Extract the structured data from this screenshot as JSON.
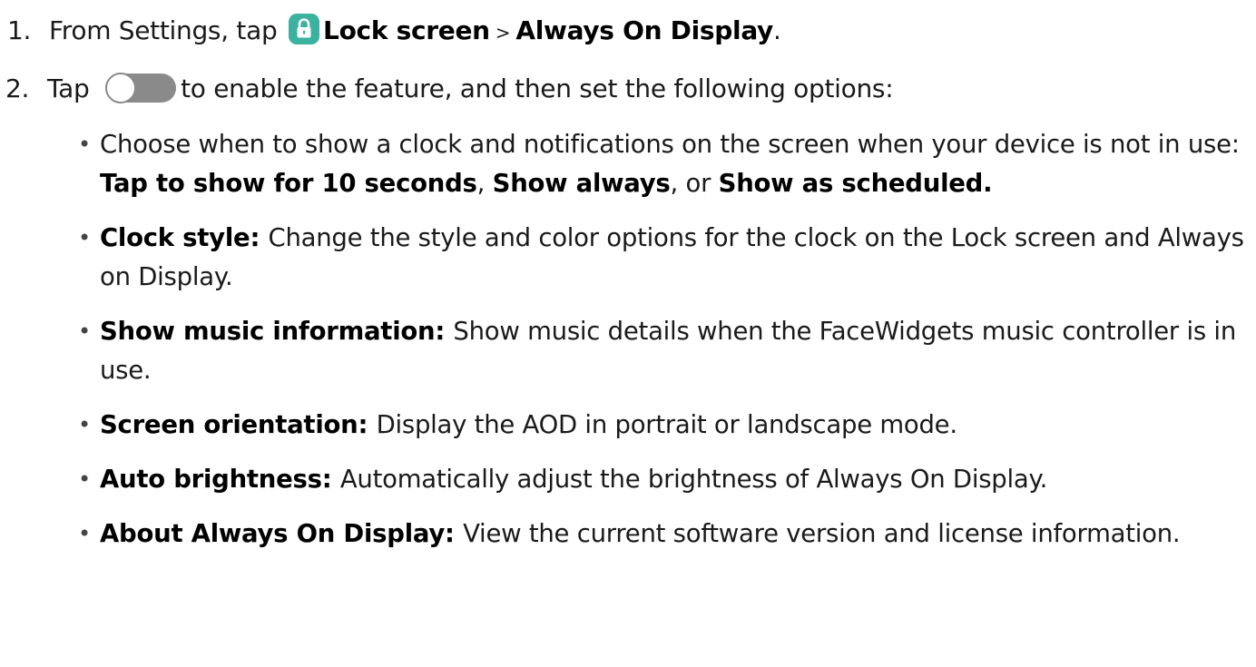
{
  "steps": [
    {
      "number": "1.",
      "prefix": "From Settings, tap",
      "icon": "lock-icon",
      "bold1": "Lock screen",
      "sep": " > ",
      "bold2": "Always On Display",
      "suffix": "."
    },
    {
      "number": "2.",
      "prefix": "Tap",
      "icon": "toggle-icon",
      "suffix": "to enable the feature, and then set the following options:"
    }
  ],
  "bullets": [
    {
      "pre": "Choose when to show a clock and notifications on the screen when your device is not in use: ",
      "b1": "Tap to show for 10 seconds",
      "mid1": ", ",
      "b2": "Show always",
      "mid2": ", or ",
      "b3": "Show as scheduled",
      "end": "."
    },
    {
      "term": "Clock style",
      "colon": ": ",
      "desc": "Change the style and color options for the clock on the Lock screen and Always on Display."
    },
    {
      "term": "Show music information",
      "colon": ": ",
      "desc": "Show music details when the FaceWidgets music controller is in use."
    },
    {
      "term": "Screen orientation",
      "colon": ": ",
      "desc": "Display the AOD in portrait or landscape mode."
    },
    {
      "term": "Auto brightness",
      "colon": ": ",
      "desc": "Automatically adjust the brightness of Always On Display."
    },
    {
      "term": "About Always On Display",
      "colon": ": ",
      "desc": "View the current software version and license information."
    }
  ],
  "bullet_glyph": "•",
  "colors": {
    "lock_icon_bg": "#3bb1a0",
    "toggle_track": "#8a8a8a",
    "text": "#1a1a1a"
  }
}
